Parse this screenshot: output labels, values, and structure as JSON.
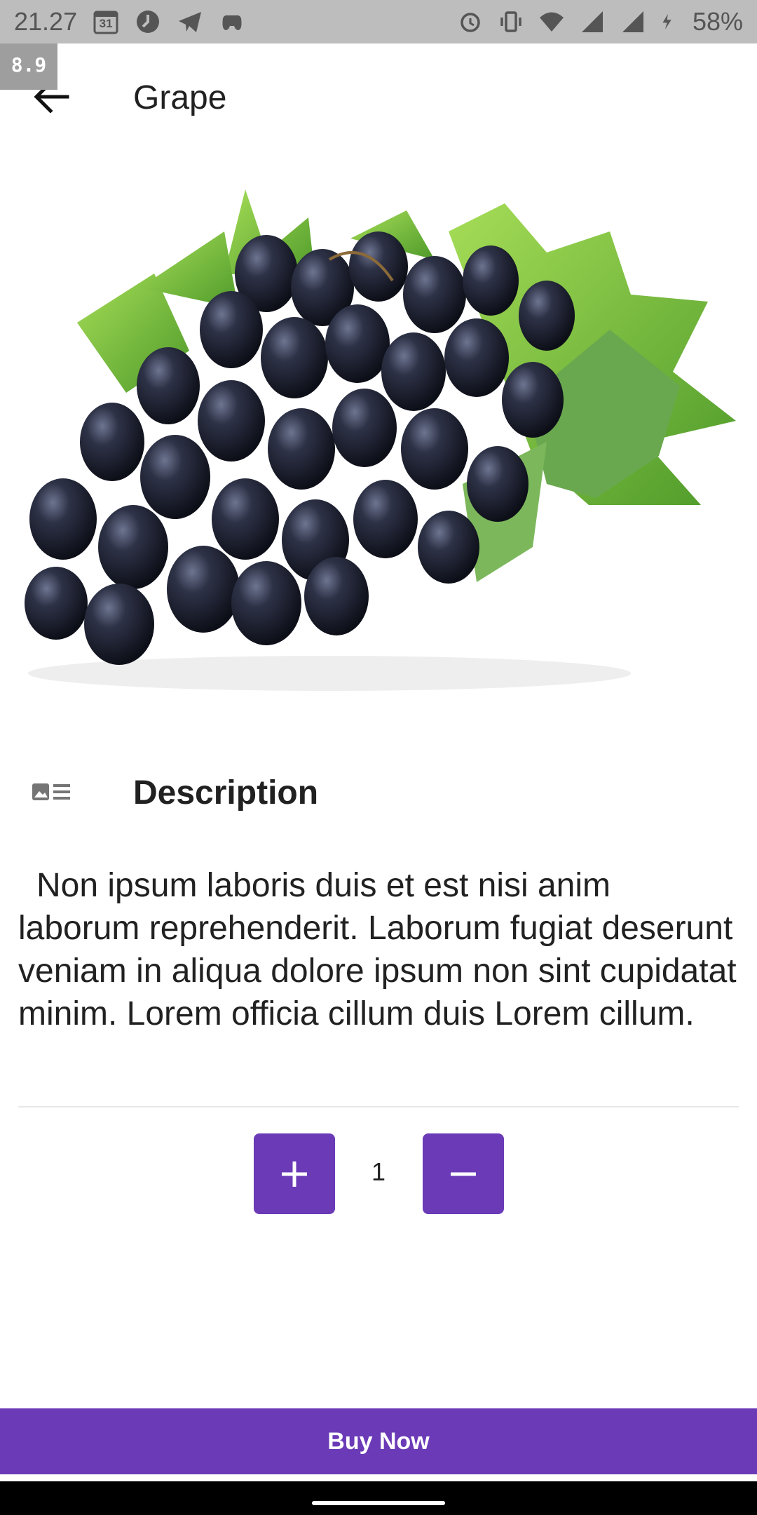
{
  "status_bar": {
    "time": "21.27",
    "calendar_day": "31",
    "battery": "58%",
    "icons_left": [
      "calendar-icon",
      "clock-app-icon",
      "telegram-icon",
      "game-controller-icon"
    ],
    "icons_right": [
      "alarm-icon",
      "vibrate-icon",
      "wifi-icon",
      "signal-icon",
      "signal-icon",
      "charging-icon"
    ]
  },
  "debug_overlay": {
    "fps": "8.9"
  },
  "app_bar": {
    "title": "Grape",
    "back_icon": "arrow-back-icon"
  },
  "product": {
    "image_alt": "Grape"
  },
  "description": {
    "heading": "Description",
    "icon": "image-list-icon",
    "text": "Non ipsum laboris duis et est nisi anim laborum reprehenderit. Laborum fugiat deserunt veniam in aliqua dolore ipsum non sint cupidatat minim. Lorem officia cillum duis Lorem cillum."
  },
  "quantity": {
    "value": "1",
    "increment_icon": "plus-icon",
    "decrement_icon": "minus-icon"
  },
  "actions": {
    "buy_label": "Buy Now"
  },
  "colors": {
    "accent": "#6a3ab7",
    "status_bar": "#bdbdbd"
  }
}
